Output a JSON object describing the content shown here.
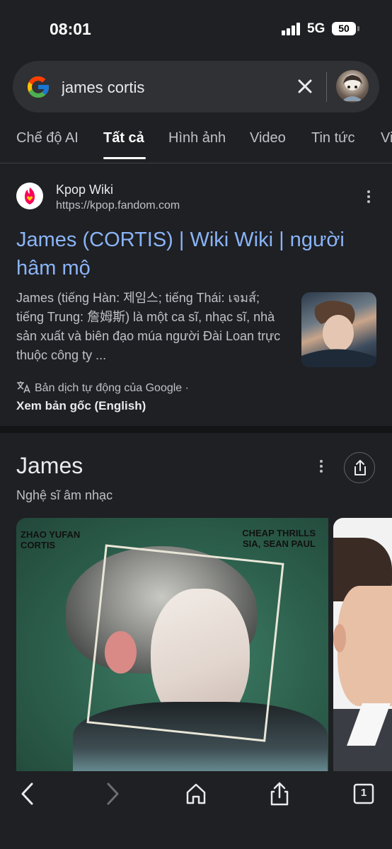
{
  "status_bar": {
    "time": "08:01",
    "network": "5G",
    "battery": "50"
  },
  "search": {
    "query": "james cortis",
    "logo": "google-g-logo",
    "clear_icon": "close-icon",
    "avatar_icon": "user-avatar"
  },
  "tabs": [
    {
      "label": "Chế độ AI",
      "active": false
    },
    {
      "label": "Tất cả",
      "active": true
    },
    {
      "label": "Hình ảnh",
      "active": false
    },
    {
      "label": "Video",
      "active": false
    },
    {
      "label": "Tin tức",
      "active": false
    },
    {
      "label": "Vi",
      "active": false
    }
  ],
  "result": {
    "site_name": "Kpop Wiki",
    "site_url": "https://kpop.fandom.com",
    "title": "James (CORTIS) | Wiki Wiki | người hâm mộ",
    "snippet": "James (tiếng Hàn: 제임스; tiếng Thái: เจมส์; tiếng Trung: 詹姆斯) là một ca sĩ, nhạc sĩ, nhà sản xuất và biên đạo múa người Đài Loan trực thuộc công ty ...",
    "translation_note": "Bản dịch tự động của Google ·",
    "view_original": "Xem bản gốc (English)"
  },
  "knowledge_panel": {
    "title": "James",
    "subtitle": "Nghệ sĩ âm nhạc",
    "album_text_left_1": "ZHAO YUFAN",
    "album_text_left_2": "CORTIS",
    "album_text_right_1": "CHEAP THRILLS",
    "album_text_right_2": "SIA, SEAN PAUL"
  },
  "bottom_bar": {
    "tab_count": "1"
  },
  "colors": {
    "background": "#1f2023",
    "link": "#8ab4f8",
    "search_bg": "#303134"
  }
}
